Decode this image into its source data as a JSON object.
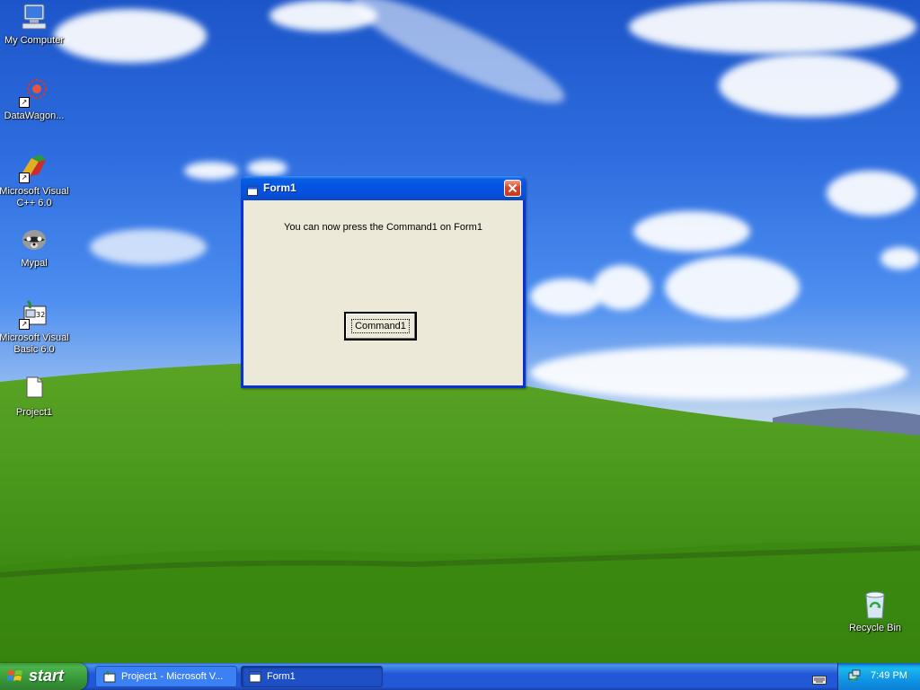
{
  "desktop": {
    "icons": [
      {
        "label": "My Computer"
      },
      {
        "label": "DataWagon..."
      },
      {
        "label": "Microsoft Visual C++ 6.0"
      },
      {
        "label": "Mypal"
      },
      {
        "label": "Microsoft Visual Basic 6.0"
      },
      {
        "label": "Project1"
      },
      {
        "label": "Recycle Bin"
      }
    ]
  },
  "window": {
    "title": "Form1",
    "message": "You can now press the Command1  on Form1",
    "button_label": "Command1"
  },
  "taskbar": {
    "start_label": "start",
    "tasks": [
      {
        "label": "Project1 - Microsoft V..."
      },
      {
        "label": "Form1"
      }
    ],
    "clock": "7:49 PM"
  },
  "colors": {
    "titlebar": "#0454e3",
    "window_face": "#ece9d8",
    "taskbar": "#2257d5",
    "start": "#379837",
    "tray": "#1196e6"
  }
}
